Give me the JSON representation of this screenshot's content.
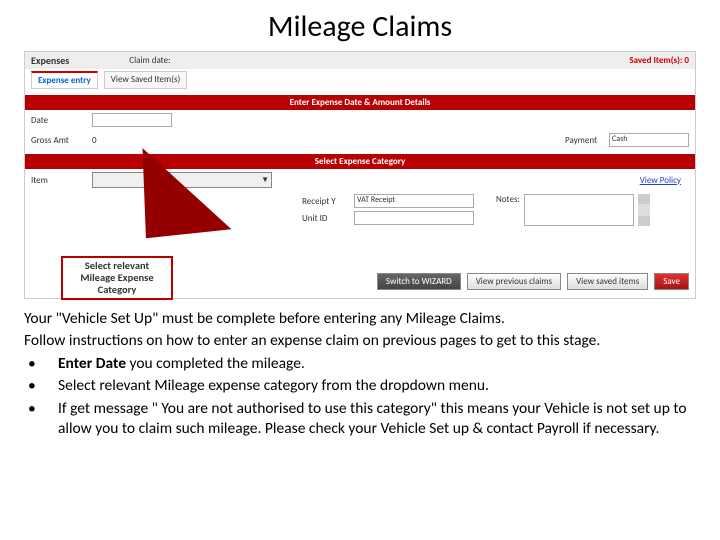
{
  "title": "Mileage Claims",
  "app": {
    "header": {
      "expenses": "Expenses",
      "claimdate": "Claim date:",
      "saved": "Saved Item(s): 0"
    },
    "tabs": {
      "entry": "Expense entry",
      "saved": "View Saved Item(s)"
    },
    "band1": "Enter Expense Date & Amount Details",
    "fields": {
      "date": "Date",
      "gross": "Gross Amt",
      "zero": "0",
      "payment": "Payment",
      "cash": "Cash"
    },
    "band2": "Select Expense Category",
    "item": "Item",
    "viewpolicy": "View Policy",
    "receipt": "Receipt Y",
    "vat": "VAT Receipt",
    "unit": "Unit ID",
    "notes": "Notes:",
    "btns": {
      "wiz": "Switch to WIZARD",
      "prev": "View previous claims",
      "savedv": "View saved items",
      "save": "Save"
    }
  },
  "callout": "Select relevant Mileage Expense Category",
  "body": {
    "p1": "Your \"Vehicle Set Up\" must be complete before entering any Mileage Claims.",
    "p2": "Follow instructions on how to enter an expense claim on previous pages to get to this stage.",
    "b1a": "Enter Date ",
    "b1b": "you completed the mileage.",
    "b2": "Select relevant Mileage expense category from the dropdown menu.",
    "b3": "If get message \" You are not authorised to use this category\" this means your Vehicle is not set up to allow you to claim such mileage. Please check your Vehicle Set up & contact Payroll if necessary."
  }
}
